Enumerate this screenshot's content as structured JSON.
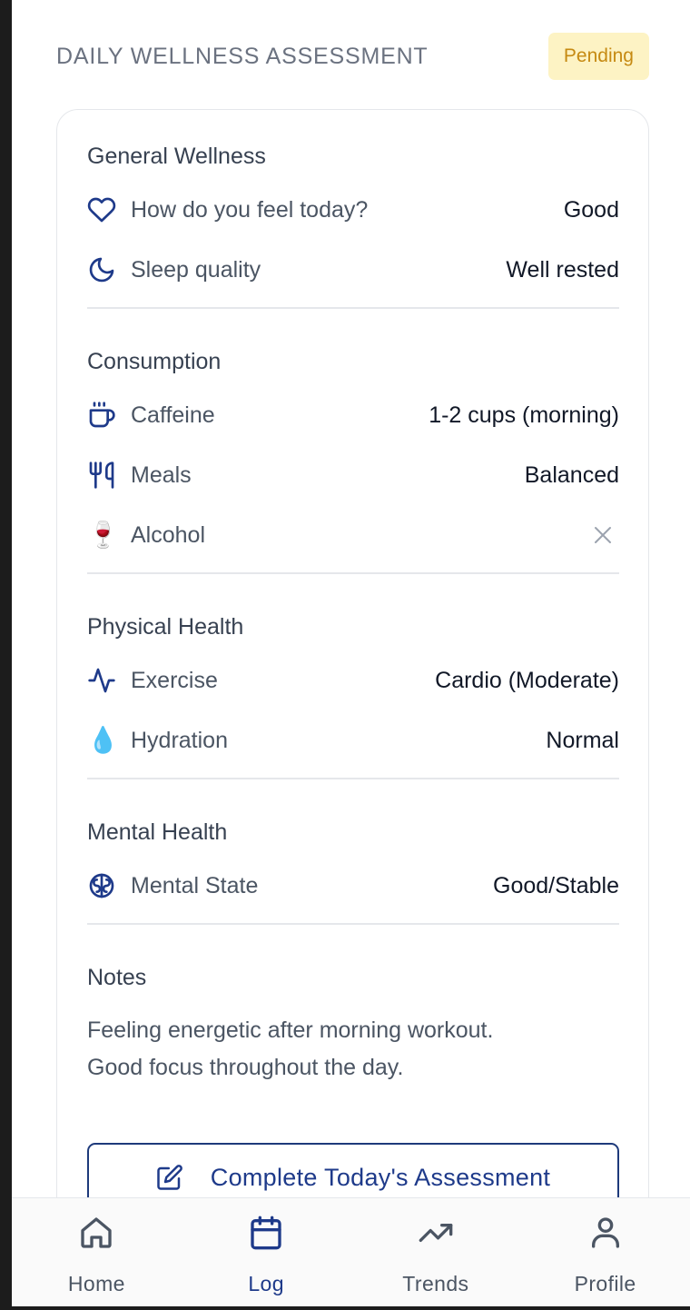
{
  "header": {
    "title": "DAILY WELLNESS ASSESSMENT",
    "status_badge": "Pending"
  },
  "sections": {
    "general": {
      "title": "General Wellness",
      "rows": [
        {
          "icon": "heart-icon",
          "label": "How do you feel today?",
          "value": "Good"
        },
        {
          "icon": "moon-icon",
          "label": "Sleep quality",
          "value": "Well rested"
        }
      ]
    },
    "consumption": {
      "title": "Consumption",
      "rows": [
        {
          "icon": "coffee-icon",
          "label": "Caffeine",
          "value": "1-2 cups (morning)"
        },
        {
          "icon": "utensils-icon",
          "label": "Meals",
          "value": "Balanced"
        },
        {
          "icon": "wine-glass-icon",
          "emoji": "🍷",
          "label": "Alcohol",
          "value": "✕"
        }
      ]
    },
    "physical": {
      "title": "Physical Health",
      "rows": [
        {
          "icon": "activity-icon",
          "label": "Exercise",
          "value": "Cardio (Moderate)"
        },
        {
          "icon": "droplet-icon",
          "emoji": "💧",
          "label": "Hydration",
          "value": "Normal"
        }
      ]
    },
    "mental": {
      "title": "Mental Health",
      "rows": [
        {
          "icon": "brain-icon",
          "label": "Mental State",
          "value": "Good/Stable"
        }
      ]
    },
    "notes": {
      "title": "Notes",
      "text_line1": "Feeling energetic after morning workout.",
      "text_line2": "Good focus throughout the day."
    }
  },
  "cta": {
    "label": "Complete Today's Assessment",
    "icon": "edit-icon"
  },
  "nav": {
    "items": [
      {
        "label": "Home",
        "icon": "home-icon"
      },
      {
        "label": "Log",
        "icon": "calendar-icon"
      },
      {
        "label": "Trends",
        "icon": "trending-up-icon"
      },
      {
        "label": "Profile",
        "icon": "user-icon"
      }
    ],
    "active_index": 1
  },
  "colors": {
    "accent": "#1e3a8a",
    "badge_bg": "#fdf3c4",
    "badge_text": "#c68a12",
    "muted_text": "#4b5563"
  }
}
